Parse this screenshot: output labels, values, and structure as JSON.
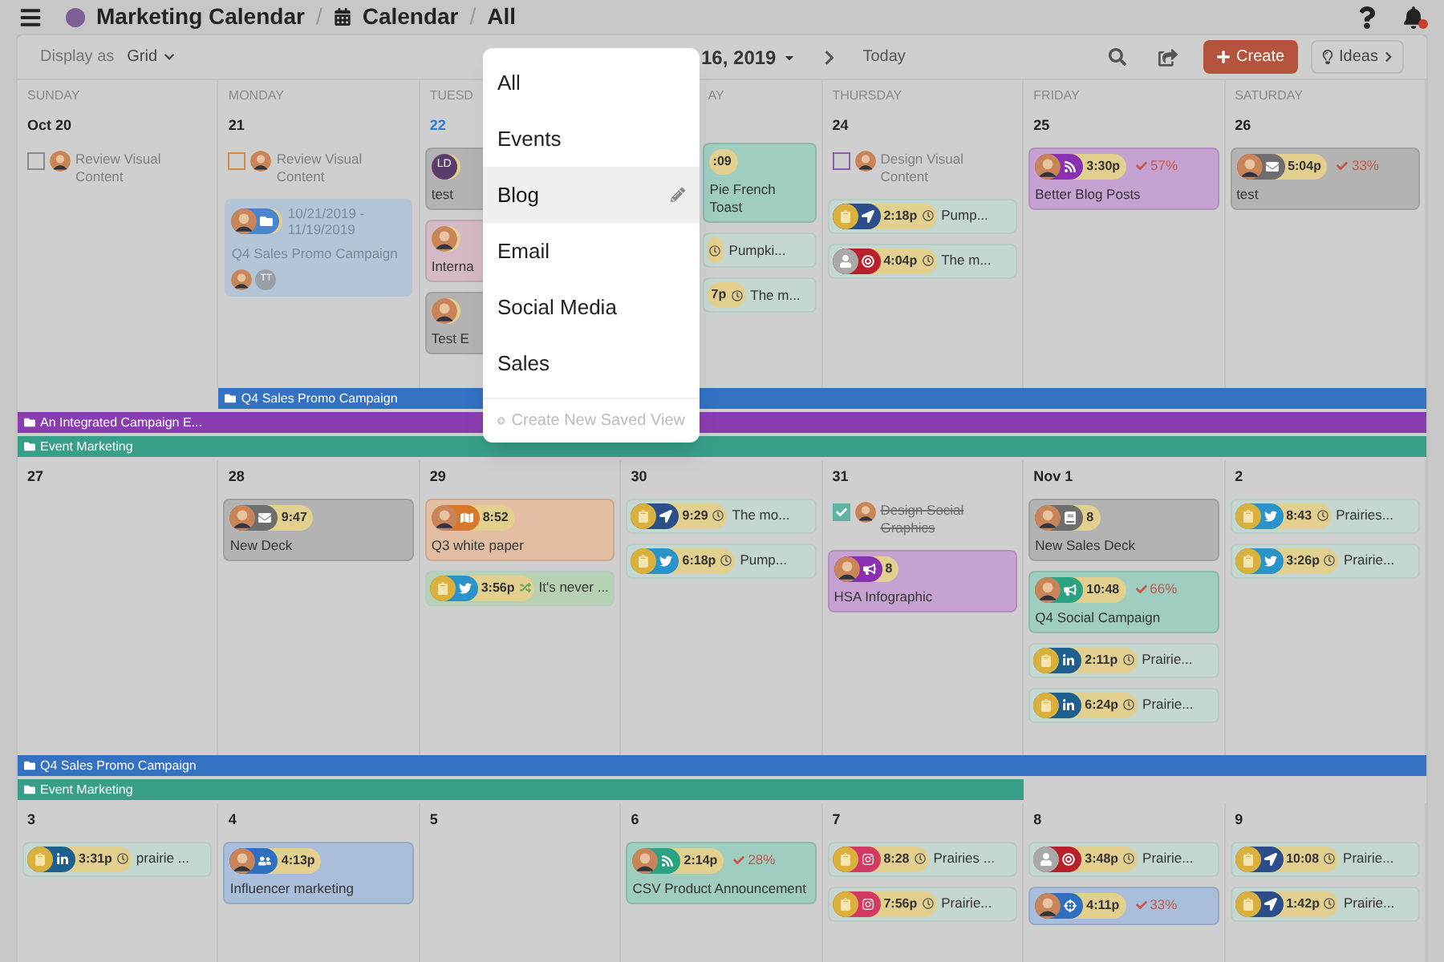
{
  "topbar": {
    "breadcrumb": [
      {
        "label": "Marketing Calendar",
        "color": "#7d5f96"
      },
      {
        "label": "Calendar"
      },
      {
        "label": "All"
      }
    ],
    "separator": "/",
    "notification": true
  },
  "toolbar": {
    "display_label": "Display as",
    "display_value": "Grid",
    "date": "16, 2019",
    "today": "Today",
    "create": "Create",
    "ideas": "Ideas"
  },
  "menu": {
    "open": true,
    "items": [
      {
        "label": "All",
        "selected": false
      },
      {
        "label": "Events",
        "selected": false
      },
      {
        "label": "Blog",
        "selected": true
      },
      {
        "label": "Email",
        "selected": false
      },
      {
        "label": "Social Media",
        "selected": false
      },
      {
        "label": "Sales",
        "selected": false
      }
    ],
    "footer": "Create New Saved View"
  },
  "weeks": [
    {
      "days": [
        {
          "name": "SUNDAY",
          "date": "Oct 20",
          "items": [
            {
              "kind": "task",
              "title": "Review Visual Content",
              "checked": false,
              "color": "#8a8a8a"
            }
          ]
        },
        {
          "name": "MONDAY",
          "date": "21",
          "items": [
            {
              "kind": "task",
              "title": "Review Visual Content",
              "checked": false,
              "color": "#d08a4a"
            },
            {
              "kind": "campaign",
              "avatar": {
                "kind": "photo"
              },
              "channel": {
                "kind": "folder",
                "color": "#4a86d0"
              },
              "dates": "10/21/2019 - 11/19/2019",
              "title": "Q4 Sales Promo Campaign",
              "members": [
                "TT"
              ],
              "color": "#b4c5d8"
            }
          ]
        },
        {
          "name": "TUESD",
          "date": "22",
          "today": true,
          "items": [
            {
              "kind": "card",
              "avatar": {
                "kind": "initials",
                "initials": "LD"
              },
              "title": "test",
              "color": "#b3b3b3"
            },
            {
              "kind": "card",
              "avatar": {
                "kind": "photo"
              },
              "title": "Interna",
              "color": "#d6b9c6"
            },
            {
              "kind": "card",
              "avatar": {
                "kind": "photo"
              },
              "title": "Test E",
              "color": "#b3b3b3"
            }
          ]
        },
        {
          "name": "AY",
          "items": [
            {
              "kind": "card",
              "time": ":09",
              "title": "Pie French Toast",
              "color": "#9fcdc0"
            },
            {
              "kind": "line",
              "clock": true,
              "title": "Pumpki..."
            },
            {
              "kind": "line",
              "time": "7p",
              "clock": true,
              "title": "The m..."
            }
          ]
        },
        {
          "name": "THURSDAY",
          "date": "24",
          "items": [
            {
              "kind": "task",
              "title": "Design Visual Content",
              "checked": false,
              "color": "#8c5ca8"
            },
            {
              "kind": "line",
              "avatar": {
                "kind": "social"
              },
              "channel": {
                "kind": "send",
                "color": "#2c4f8c"
              },
              "time": "2:18p",
              "clock": true,
              "title": "Pump..."
            },
            {
              "kind": "line",
              "avatar": {
                "kind": "generic"
              },
              "channel": {
                "kind": "target",
                "color": "#b8202c"
              },
              "time": "4:04p",
              "clock": true,
              "title": "The m..."
            }
          ]
        },
        {
          "name": "FRIDAY",
          "date": "25",
          "items": [
            {
              "kind": "card",
              "avatar": {
                "kind": "photo"
              },
              "channel": {
                "kind": "rss",
                "color": "#8a2fb0"
              },
              "time": "3:30p",
              "progress": "57%",
              "title": "Better Blog Posts",
              "color": "#c6a2d2"
            }
          ]
        },
        {
          "name": "SATURDAY",
          "date": "26",
          "items": [
            {
              "kind": "card",
              "avatar": {
                "kind": "photo"
              },
              "channel": {
                "kind": "email",
                "color": "#6e6e6e"
              },
              "time": "5:04p",
              "progress": "33%",
              "title": "test",
              "color": "#b3b3b3"
            }
          ]
        }
      ],
      "bars": [
        {
          "label": "Q4 Sales Promo Campaign",
          "color": "#3471c2",
          "days": [
            false,
            true,
            true,
            true,
            true,
            true,
            true
          ]
        },
        {
          "label": "An Integrated Campaign E...",
          "color": "#8a3db0",
          "days": [
            true,
            true,
            true,
            true,
            true,
            true,
            true
          ]
        },
        {
          "label": "Event Marketing",
          "color": "#379f88",
          "days": [
            true,
            true,
            true,
            true,
            true,
            true,
            true
          ]
        }
      ]
    },
    {
      "days": [
        {
          "date": "27"
        },
        {
          "date": "28",
          "items": [
            {
              "kind": "card",
              "avatar": {
                "kind": "photo"
              },
              "channel": {
                "kind": "email",
                "color": "#6e6e6e"
              },
              "time": "9:47",
              "title": "New Deck",
              "color": "#b3b3b3"
            }
          ]
        },
        {
          "date": "29",
          "items": [
            {
              "kind": "card",
              "avatar": {
                "kind": "photo"
              },
              "channel": {
                "kind": "paper",
                "color": "#d9782c"
              },
              "time": "8:52",
              "title": "Q3 white paper",
              "color": "#e3bea2"
            },
            {
              "kind": "line",
              "avatar": {
                "kind": "social"
              },
              "channel": {
                "kind": "bird",
                "color": "#2a93c9"
              },
              "time": "3:56p",
              "shuffle": true,
              "title": "It's never ...",
              "color": "#b6d1b3"
            }
          ]
        },
        {
          "date": "30",
          "items": [
            {
              "kind": "line",
              "avatar": {
                "kind": "social"
              },
              "channel": {
                "kind": "send",
                "color": "#2c4f8c"
              },
              "time": "9:29",
              "clock": true,
              "title": "The mo..."
            },
            {
              "kind": "line",
              "avatar": {
                "kind": "social"
              },
              "channel": {
                "kind": "bird",
                "color": "#2a93c9"
              },
              "time": "6:18p",
              "clock": true,
              "title": "Pump..."
            }
          ]
        },
        {
          "date": "31",
          "items": [
            {
              "kind": "task",
              "title": "Design Social Graphics",
              "checked": true,
              "color": "#5fb3a3"
            },
            {
              "kind": "card",
              "avatar": {
                "kind": "photo"
              },
              "channel": {
                "kind": "megaphone",
                "color": "#8a2fb0"
              },
              "time": "8",
              "title": "HSA Infographic",
              "color": "#c6a2d2"
            }
          ]
        },
        {
          "date": "Nov 1",
          "items": [
            {
              "kind": "card",
              "avatar": {
                "kind": "photo"
              },
              "channel": {
                "kind": "book",
                "color": "#6e6e6e"
              },
              "time": "8",
              "title": "New Sales Deck",
              "color": "#b3b3b3"
            },
            {
              "kind": "card",
              "avatar": {
                "kind": "photo"
              },
              "channel": {
                "kind": "megaphone",
                "color": "#2aa383"
              },
              "time": "10:48",
              "progress": "66%",
              "title": "Q4 Social Campaign",
              "color": "#9fcdc0"
            },
            {
              "kind": "line",
              "avatar": {
                "kind": "social"
              },
              "channel": {
                "kind": "in",
                "color": "#1d5f8f"
              },
              "time": "2:11p",
              "clock": true,
              "title": "Prairie..."
            },
            {
              "kind": "line",
              "avatar": {
                "kind": "social"
              },
              "channel": {
                "kind": "in",
                "color": "#1d5f8f"
              },
              "time": "6:24p",
              "clock": true,
              "title": "Prairie..."
            }
          ]
        },
        {
          "date": "2",
          "items": [
            {
              "kind": "line",
              "avatar": {
                "kind": "social"
              },
              "channel": {
                "kind": "bird",
                "color": "#2a93c9"
              },
              "time": "8:43",
              "clock": true,
              "title": "Prairies..."
            },
            {
              "kind": "line",
              "avatar": {
                "kind": "social"
              },
              "channel": {
                "kind": "bird",
                "color": "#2a93c9"
              },
              "time": "3:26p",
              "clock": true,
              "title": "Prairie..."
            }
          ]
        }
      ],
      "bars": [
        {
          "label": "Q4 Sales Promo Campaign",
          "color": "#3471c2",
          "days": [
            true,
            true,
            true,
            true,
            true,
            true,
            true
          ]
        },
        {
          "label": "Event Marketing",
          "color": "#379f88",
          "days": [
            true,
            true,
            true,
            true,
            true,
            false,
            false
          ]
        }
      ]
    },
    {
      "days": [
        {
          "date": "3",
          "items": [
            {
              "kind": "line",
              "avatar": {
                "kind": "social"
              },
              "channel": {
                "kind": "in",
                "color": "#1d5f8f"
              },
              "time": "3:31p",
              "clock": true,
              "title": "prairie ..."
            }
          ]
        },
        {
          "date": "4",
          "items": [
            {
              "kind": "card",
              "avatar": {
                "kind": "photo"
              },
              "channel": {
                "kind": "people",
                "color": "#2f6fc2"
              },
              "time": "4:13p",
              "title": "Influencer marketing",
              "color": "#a9bedb"
            }
          ]
        },
        {
          "date": "5"
        },
        {
          "date": "6",
          "items": [
            {
              "kind": "card",
              "avatar": {
                "kind": "photo"
              },
              "channel": {
                "kind": "rss",
                "color": "#2aa383"
              },
              "time": "2:14p",
              "progress": "28%",
              "title": "CSV Product Announcement",
              "color": "#9fcdc0"
            }
          ]
        },
        {
          "date": "7",
          "items": [
            {
              "kind": "line",
              "avatar": {
                "kind": "social"
              },
              "channel": {
                "kind": "camera",
                "color": "#d23a63"
              },
              "time": "8:28",
              "clock": true,
              "title": "Prairies ..."
            },
            {
              "kind": "line",
              "avatar": {
                "kind": "social"
              },
              "channel": {
                "kind": "camera",
                "color": "#d23a63"
              },
              "time": "7:56p",
              "clock": true,
              "title": "Prairie..."
            }
          ]
        },
        {
          "date": "8",
          "items": [
            {
              "kind": "line",
              "avatar": {
                "kind": "generic"
              },
              "channel": {
                "kind": "target",
                "color": "#b8202c"
              },
              "time": "3:48p",
              "clock": true,
              "title": "Prairie..."
            },
            {
              "kind": "card",
              "avatar": {
                "kind": "photo"
              },
              "channel": {
                "kind": "crosshair",
                "color": "#2f6fc2"
              },
              "time": "4:11p",
              "progress": "33%",
              "color": "#a9bedb"
            }
          ]
        },
        {
          "date": "9",
          "items": [
            {
              "kind": "line",
              "avatar": {
                "kind": "social"
              },
              "channel": {
                "kind": "send",
                "color": "#2c4f8c"
              },
              "time": "10:08",
              "clock": true,
              "title": "Prairie..."
            },
            {
              "kind": "line",
              "avatar": {
                "kind": "social"
              },
              "channel": {
                "kind": "send",
                "color": "#2c4f8c"
              },
              "time": "1:42p",
              "clock": true,
              "title": "Prairie..."
            }
          ]
        }
      ]
    }
  ]
}
